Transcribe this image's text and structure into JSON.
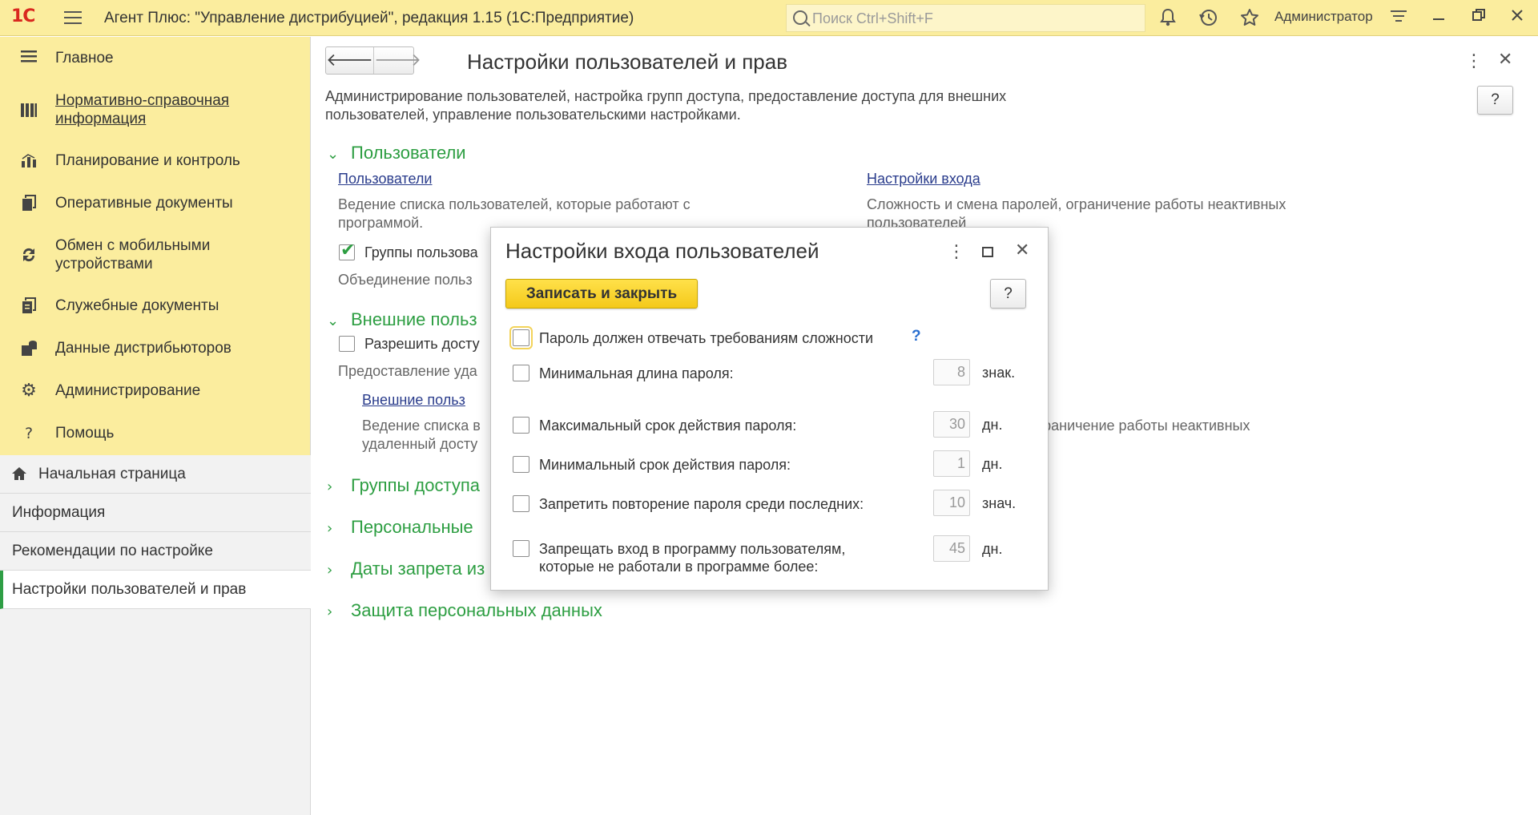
{
  "topbar": {
    "logo": "1С",
    "title": "Агент Плюс: \"Управление дистрибуцией\", редакция 1.15  (1С:Предприятие)",
    "search_placeholder": "Поиск Ctrl+Shift+F",
    "user": "Администратор",
    "icons": [
      "bell-icon",
      "history-icon",
      "star-icon",
      "menu-lines-icon",
      "minimize-icon",
      "restore-icon",
      "close-icon"
    ]
  },
  "sidebar": {
    "sections": [
      {
        "label": "Главное",
        "icon": "list-icon"
      },
      {
        "label": "Нормативно-справочная информация",
        "line1": "Нормативно-справочная",
        "line2": "информация",
        "icon": "books-icon"
      },
      {
        "label": "Планирование и контроль",
        "icon": "bar-chart-icon"
      },
      {
        "label": "Оперативные документы",
        "icon": "documents-icon"
      },
      {
        "label": "Обмен с мобильными устройствами",
        "line1": "Обмен с мобильными",
        "line2": "устройствами",
        "icon": "sync-icon"
      },
      {
        "label": "Служебные документы",
        "icon": "service-docs-icon"
      },
      {
        "label": "Данные дистрибьюторов",
        "icon": "distributor-data-icon"
      },
      {
        "label": "Администрирование",
        "icon": "gear-icon"
      },
      {
        "label": "Помощь",
        "icon": "question-icon"
      }
    ],
    "open_items": [
      {
        "label": "Начальная страница"
      },
      {
        "label": "Информация"
      },
      {
        "label": "Рекомендации по настройке"
      },
      {
        "label": "Настройки пользователей и прав"
      }
    ]
  },
  "main": {
    "title": "Настройки пользователей и прав",
    "description": "Администрирование пользователей, настройка групп доступа, предоставление доступа для внешних пользователей, управление пользовательскими настройками.",
    "help": "?",
    "groups": {
      "users": "Пользователи",
      "external": "Внешние польз",
      "access_groups": "Группы доступа",
      "personal": "Персональные",
      "dates": "Даты запрета из",
      "protection": "Защита персональных данных"
    },
    "users_link": "Пользователи",
    "users_desc": "Ведение списка пользователей, которые работают с программой.",
    "login_link": "Настройки входа",
    "login_desc_1": "Сложность и смена паролей, ограничение работы неактивных",
    "login_desc_1b": "пользователей",
    "groups_cb": "Группы пользова",
    "groups_desc": "Объединение польз",
    "allow_cb": "Разрешить досту",
    "allow_desc": "Предоставление уда",
    "ext_link": "Внешние польз",
    "ext_desc_1": "Ведение списка в",
    "ext_desc_2": "удаленный досту",
    "ext_login_desc": "лей, ограничение работы неактивных"
  },
  "dialog": {
    "title": "Настройки входа пользователей",
    "save_button": "Записать и закрыть",
    "help": "?",
    "rows": [
      {
        "label": "Пароль должен отвечать требованиям сложности",
        "hint": "?"
      },
      {
        "label": "Минимальная длина пароля:",
        "value": "8",
        "unit": "знак."
      },
      {
        "label": "Максимальный срок действия пароля:",
        "value": "30",
        "unit": "дн."
      },
      {
        "label": "Минимальный срок действия пароля:",
        "value": "1",
        "unit": "дн."
      },
      {
        "label": "Запретить повторение пароля среди последних:",
        "value": "10",
        "unit": "знач."
      },
      {
        "label_1": "Запрещать вход в программу пользователям,",
        "label_2": "которые не работали в программе более:",
        "value": "45",
        "unit": "дн."
      }
    ]
  },
  "colors": {
    "accent_green": "#2d9e42",
    "topbar_yellow": "#fbed9e",
    "save_yellow": "#f4c91a",
    "logo_red": "#d9281f"
  }
}
